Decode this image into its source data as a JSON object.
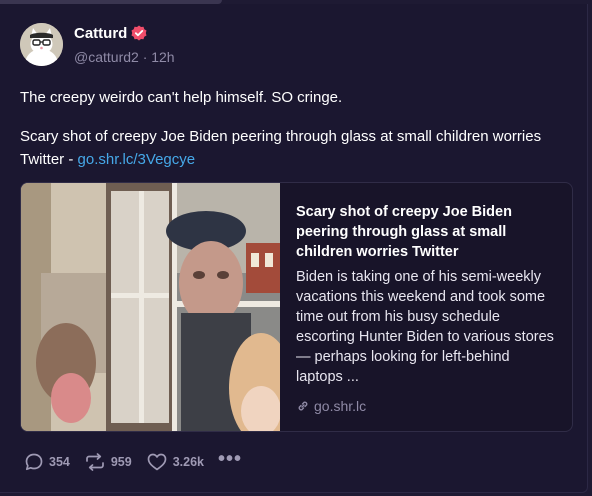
{
  "post": {
    "author_name": "Catturd",
    "author_handle": "@catturd2 · 12h",
    "text_line1": "The creepy weirdo can't help himself. SO cringe.",
    "text_line2_prefix": "Scary shot of creepy Joe Biden peering through glass at small children worries Twitter - ",
    "text_line2_link": "go.shr.lc/3Vegcye",
    "link_color": "#46a8e8",
    "verified_color": "#f04d6a"
  },
  "card": {
    "title": "Scary shot of creepy Joe Biden peering through glass at small children worries Twitter",
    "description": "Biden is taking one of his semi-weekly vacations this weekend and took some time out from his busy schedule escorting Hunter Biden to various stores — perhaps looking for left-behind laptops ...",
    "domain": "go.shr.lc"
  },
  "actions": {
    "reply_count": "354",
    "repost_count": "959",
    "like_count": "3.26k",
    "more_label": "•••"
  },
  "icons": [
    "verified-badge-icon",
    "link-icon",
    "reply-icon",
    "repost-icon",
    "like-icon",
    "more-icon"
  ]
}
